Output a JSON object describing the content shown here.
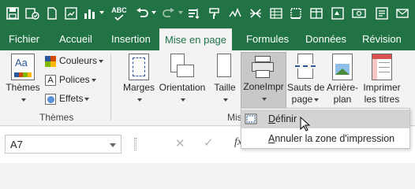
{
  "colors": {
    "brand": "#217346",
    "ribbon_bg": "#f3f3f3",
    "menu_highlight": "#d3d3d3"
  },
  "quick_access": {
    "icons": [
      "save-icon",
      "autosave-icon",
      "new-file-icon",
      "chart-icon",
      "spelling-icon",
      "undo-icon",
      "redo-icon",
      "sort-icon",
      "format-painter-icon",
      "strikethrough-icon",
      "table-icon",
      "currency-icon",
      "number-format-icon"
    ],
    "spelling_glyph": "ABC"
  },
  "tabs": [
    {
      "label": "Fichier"
    },
    {
      "label": "Accueil"
    },
    {
      "label": "Insertion"
    },
    {
      "label": "Mise en page",
      "active": true
    },
    {
      "label": "Formules"
    },
    {
      "label": "Données"
    },
    {
      "label": "Révision"
    }
  ],
  "ribbon": {
    "themes_group": {
      "label": "Thèmes",
      "themes_button": "Thèmes",
      "themes_icon_glyph": "Aa",
      "colors": "Couleurs",
      "fonts": "Polices",
      "fonts_glyph": "A",
      "effects": "Effets"
    },
    "page_setup_group": {
      "label_visible": "Mis",
      "margins": "Marges",
      "orientation": "Orientation",
      "size": "Taille",
      "print_area": "ZoneImpr",
      "breaks_line1": "Sauts de",
      "breaks_line2": "page",
      "background_line1": "Arrière-",
      "background_line2": "plan",
      "print_titles_line1": "Imprimer",
      "print_titles_line2": "les titres"
    }
  },
  "formula_bar": {
    "name_box": "A7",
    "fx": "fx"
  },
  "print_area_menu": {
    "items": [
      {
        "label": "Définir",
        "underline": "D",
        "rest": "éfinir",
        "highlighted": true
      },
      {
        "label": "Annuler la zone d'impression",
        "underline": "A",
        "rest": "nnuler la zone d'impression",
        "highlighted": false
      }
    ]
  }
}
